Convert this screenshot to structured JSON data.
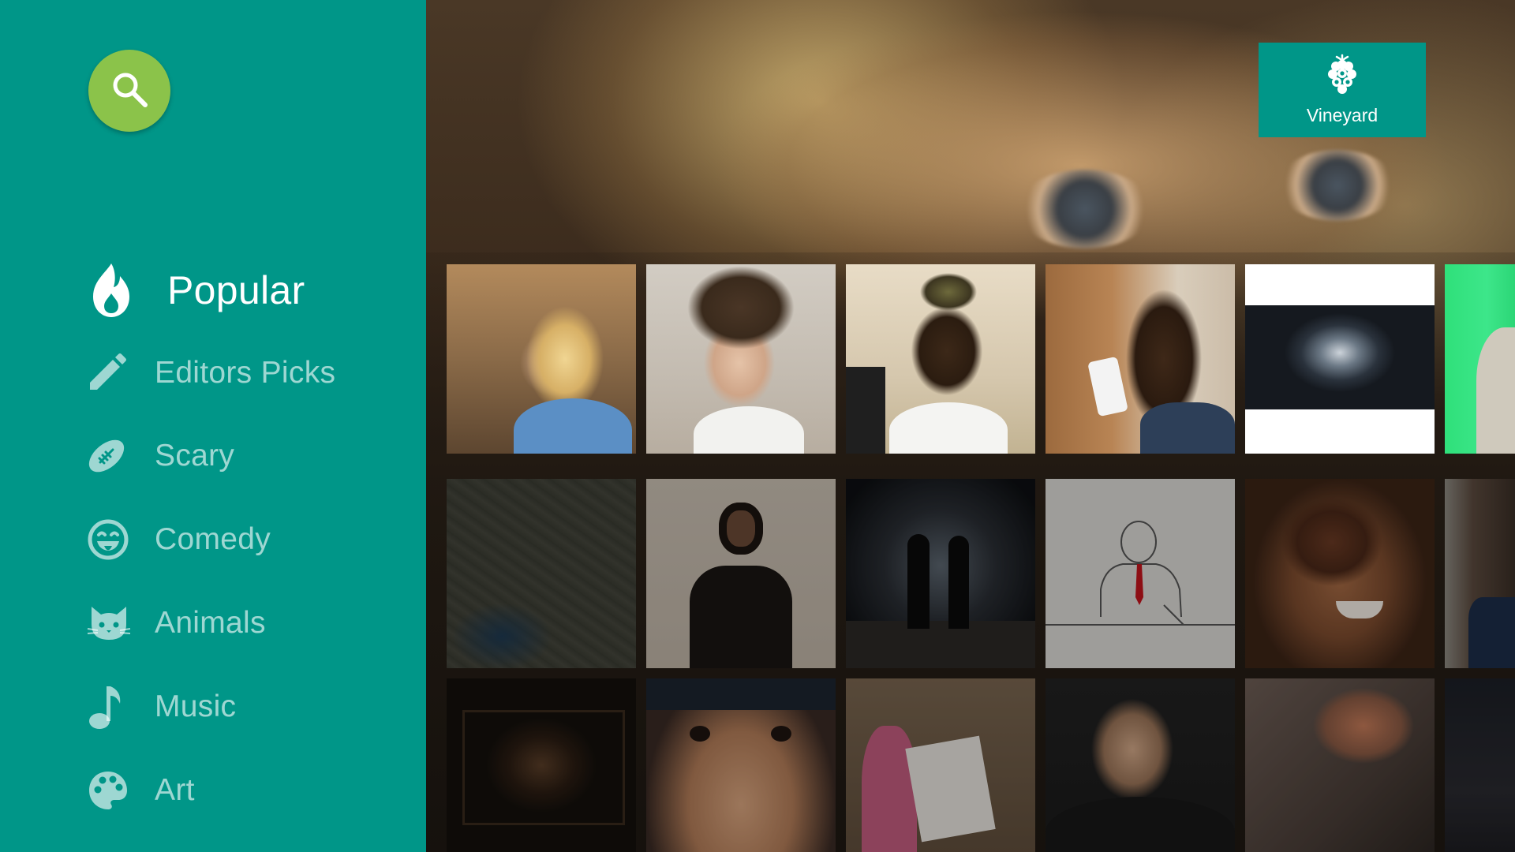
{
  "sidebar": {
    "search_icon": "search-icon",
    "items": [
      {
        "label": "Popular",
        "icon": "flame-icon",
        "active": true
      },
      {
        "label": "Editors Picks",
        "icon": "pencil-icon",
        "active": false
      },
      {
        "label": "Scary",
        "icon": "football-icon",
        "active": false
      },
      {
        "label": "Comedy",
        "icon": "tongue-face-icon",
        "active": false
      },
      {
        "label": "Animals",
        "icon": "cat-icon",
        "active": false
      },
      {
        "label": "Music",
        "icon": "music-note-icon",
        "active": false
      },
      {
        "label": "Art",
        "icon": "palette-icon",
        "active": false
      }
    ]
  },
  "brand": {
    "name": "Vineyard",
    "icon": "grapes-icon"
  },
  "grid": {
    "rows": [
      [
        "thumbnail",
        "thumbnail",
        "thumbnail",
        "thumbnail",
        "thumbnail",
        "thumbnail"
      ],
      [
        "thumbnail",
        "thumbnail",
        "thumbnail",
        "thumbnail",
        "thumbnail",
        "thumbnail"
      ],
      [
        "thumbnail",
        "thumbnail",
        "thumbnail",
        "thumbnail",
        "thumbnail",
        "thumbnail"
      ]
    ]
  },
  "colors": {
    "sidebar": "#009688",
    "search_button": "#8bc34a",
    "brand_badge": "#009688"
  }
}
